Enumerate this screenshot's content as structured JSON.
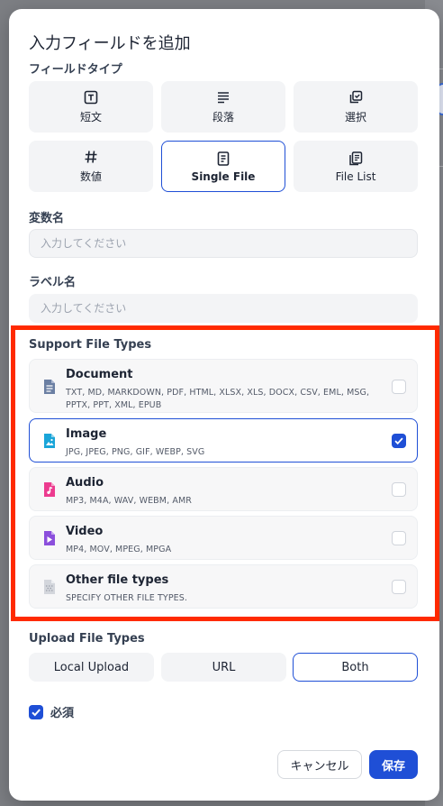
{
  "modal": {
    "title": "入力フィールドを追加"
  },
  "field_type": {
    "label": "フィールドタイプ",
    "options": [
      {
        "label": "短文",
        "icon": "text-box-icon",
        "selected": false
      },
      {
        "label": "段落",
        "icon": "paragraph-lines-icon",
        "selected": false
      },
      {
        "label": "選択",
        "icon": "select-stack-icon",
        "selected": false
      },
      {
        "label": "数値",
        "icon": "hash-icon",
        "selected": false
      },
      {
        "label": "Single File",
        "icon": "file-icon",
        "selected": true
      },
      {
        "label": "File List",
        "icon": "file-list-icon",
        "selected": false
      }
    ]
  },
  "variable_name": {
    "label": "変数名",
    "placeholder": "入力してください",
    "value": ""
  },
  "label_name": {
    "label": "ラベル名",
    "placeholder": "入力してください",
    "value": ""
  },
  "support_file_types": {
    "label": "Support File Types",
    "items": [
      {
        "name": "Document",
        "desc": "TXT, MD, MARKDOWN, PDF, HTML, XLSX, XLS, DOCX, CSV, EML, MSG, PPTX, PPT, XML, EPUB",
        "icon": "document-icon",
        "checked": false
      },
      {
        "name": "Image",
        "desc": "JPG, JPEG, PNG, GIF, WEBP, SVG",
        "icon": "image-icon",
        "checked": true
      },
      {
        "name": "Audio",
        "desc": "MP3, M4A, WAV, WEBM, AMR",
        "icon": "audio-icon",
        "checked": false
      },
      {
        "name": "Video",
        "desc": "MP4, MOV, MPEG, MPGA",
        "icon": "video-icon",
        "checked": false
      },
      {
        "name": "Other file types",
        "desc": "SPECIFY OTHER FILE TYPES.",
        "icon": "other-file-icon",
        "checked": false
      }
    ]
  },
  "upload_file_types": {
    "label": "Upload File Types",
    "options": [
      {
        "label": "Local Upload",
        "selected": false
      },
      {
        "label": "URL",
        "selected": false
      },
      {
        "label": "Both",
        "selected": true
      }
    ]
  },
  "required": {
    "label": "必須",
    "checked": true
  },
  "actions": {
    "cancel": "キャンセル",
    "save": "保存"
  },
  "colors": {
    "accent": "#1f4fd6",
    "highlight": "#ff2a00",
    "document": "#6b7fa3",
    "image": "#1aa5d9",
    "audio": "#ec3b8f",
    "video": "#8b4fdc",
    "other": "#b8bcc4"
  }
}
